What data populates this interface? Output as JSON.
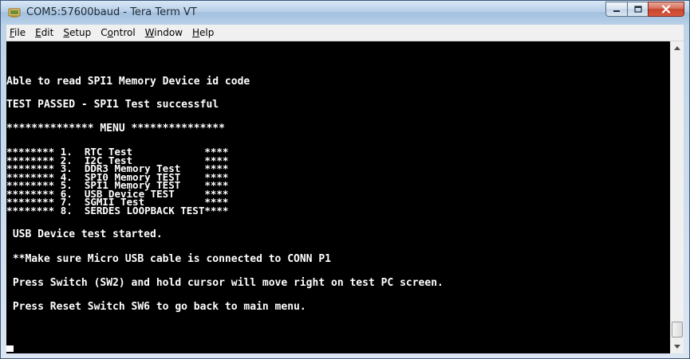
{
  "window": {
    "title": "COM5:57600baud - Tera Term VT",
    "buttons": {
      "minimize": "minimize",
      "maximize": "maximize",
      "close": "close"
    }
  },
  "menu": [
    {
      "accel": "F",
      "rest": "ile"
    },
    {
      "accel": "E",
      "rest": "dit"
    },
    {
      "accel": "S",
      "rest": "etup"
    },
    {
      "pre": "C",
      "accel": "o",
      "rest": "ntrol"
    },
    {
      "accel": "W",
      "rest": "indow"
    },
    {
      "accel": "H",
      "rest": "elp"
    }
  ],
  "terminal": {
    "line1": "Able to read SPI1 Memory Device id code",
    "line2": "TEST PASSED - SPI1 Test successful",
    "menu_header": "************** MENU ***************",
    "menu_items": [
      "******** 1.  RTC Test            ****",
      "******** 2.  I2C Test            ****",
      "******** 3.  DDR3 Memory Test    ****",
      "******** 4.  SPI0 Memory TEST    ****",
      "******** 5.  SPI1 Memory TEST    ****",
      "******** 6.  USB Device TEST     ****",
      "******** 7.  SGMII Test          ****",
      "******** 8.  SERDES LOOPBACK TEST****"
    ],
    "line_usb": " USB Device test started.",
    "line_make_sure": " **Make sure Micro USB cable is connected to CONN P1",
    "line_press_switch": " Press Switch (SW2) and hold cursor will move right on test PC screen.",
    "line_press_reset": " Press Reset Switch SW6 to go back to main menu."
  },
  "colors": {
    "terminal_bg": "#000000",
    "terminal_fg": "#ffffff",
    "close_button": "#c5442d"
  },
  "icons": {
    "app": "tera-term-icon",
    "scroll_up": "scroll-up-arrow-icon",
    "scroll_down": "scroll-down-arrow-icon"
  }
}
